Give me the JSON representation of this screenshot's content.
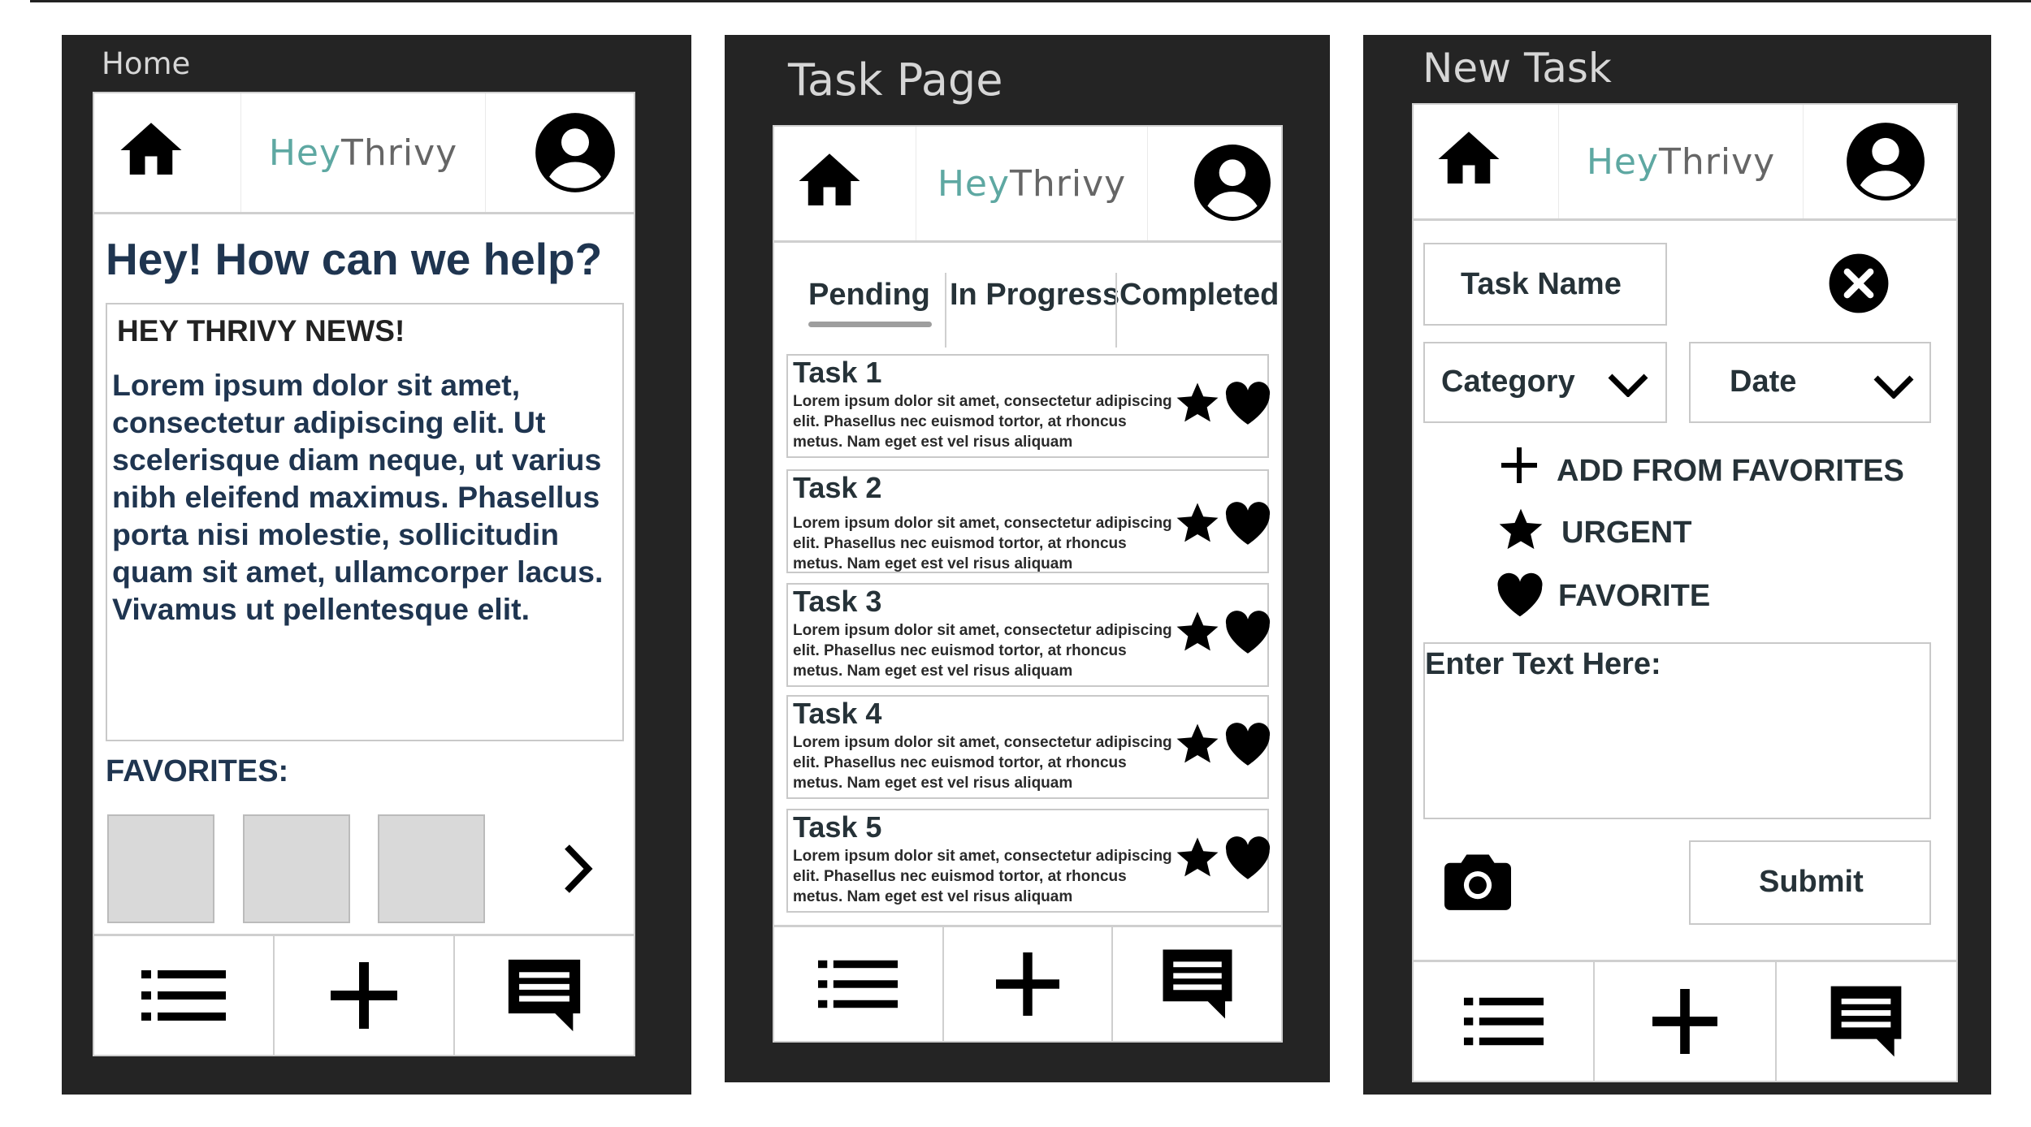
{
  "app": {
    "logo_left": "Hey",
    "logo_right": "Thrivy"
  },
  "screens": {
    "home": {
      "frame_title": "Home",
      "greeting": "Hey! How can we help?",
      "news_title": "HEY THRIVY NEWS!",
      "news_body": "Lorem ipsum dolor sit amet, consectetur adipiscing elit. Ut scelerisque diam neque, ut varius nibh eleifend maximus. Phasellus porta nisi molestie, sollicitudin quam sit amet, ullamcorper lacus. Vivamus ut pellentesque elit.",
      "favorites_label": "FAVORITES:"
    },
    "task_page": {
      "frame_title": "Task Page",
      "tabs": [
        "Pending",
        "In Progress",
        "Completed"
      ],
      "tasks": [
        {
          "title": "Task 1",
          "description": "Lorem ipsum dolor sit amet, consectetur adipiscing elit. Phasellus nec euismod tortor, at rhoncus metus. Nam eget est vel risus aliquam"
        },
        {
          "title": "Task 2",
          "description": "Lorem ipsum dolor sit amet, consectetur adipiscing elit. Phasellus nec euismod tortor, at rhoncus metus. Nam eget est vel risus aliquam"
        },
        {
          "title": "Task 3",
          "description": "Lorem ipsum dolor sit amet, consectetur adipiscing elit. Phasellus nec euismod tortor, at rhoncus metus. Nam eget est vel risus aliquam"
        },
        {
          "title": "Task 4",
          "description": "Lorem ipsum dolor sit amet, consectetur adipiscing elit. Phasellus nec euismod tortor, at rhoncus metus. Nam eget est vel risus aliquam"
        },
        {
          "title": "Task 5",
          "description": "Lorem ipsum dolor sit amet, consectetur adipiscing elit. Phasellus nec euismod tortor, at rhoncus metus. Nam eget est vel risus aliquam"
        }
      ]
    },
    "new_task": {
      "frame_title": "New Task",
      "task_name_placeholder": "Task Name",
      "category_label": "Category",
      "date_label": "Date",
      "add_from_favorites": "ADD FROM FAVORITES",
      "urgent": "URGENT",
      "favorite": "FAVORITE",
      "text_placeholder": "Enter Text Here:",
      "submit_label": "Submit"
    }
  },
  "icons": [
    "home-icon",
    "user-icon",
    "list-icon",
    "plus-icon",
    "chat-icon",
    "star-icon",
    "heart-icon",
    "close-icon",
    "chevron-down-icon",
    "chevron-right-icon",
    "camera-icon"
  ],
  "colors": {
    "frame": "#242424",
    "logo_accent": "#5ea8a2",
    "text": "#1f2d3d",
    "placeholder_tile": "#d9d9d9"
  }
}
